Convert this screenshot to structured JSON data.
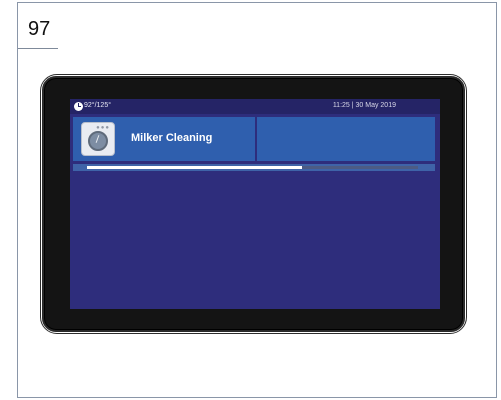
{
  "page": {
    "number": "97"
  },
  "status_bar": {
    "icon": "clock-icon",
    "temperature": "92°/125°",
    "datetime": "11:25 | 30 May 2019"
  },
  "task": {
    "icon": "milker-cleaning-icon",
    "title": "Milker Cleaning"
  },
  "progress": {
    "value_fraction": 0.65
  },
  "colors": {
    "screen_background": "#2e2d7c",
    "card_background": "#2f5fae",
    "progress_fill": "#ffffff"
  }
}
